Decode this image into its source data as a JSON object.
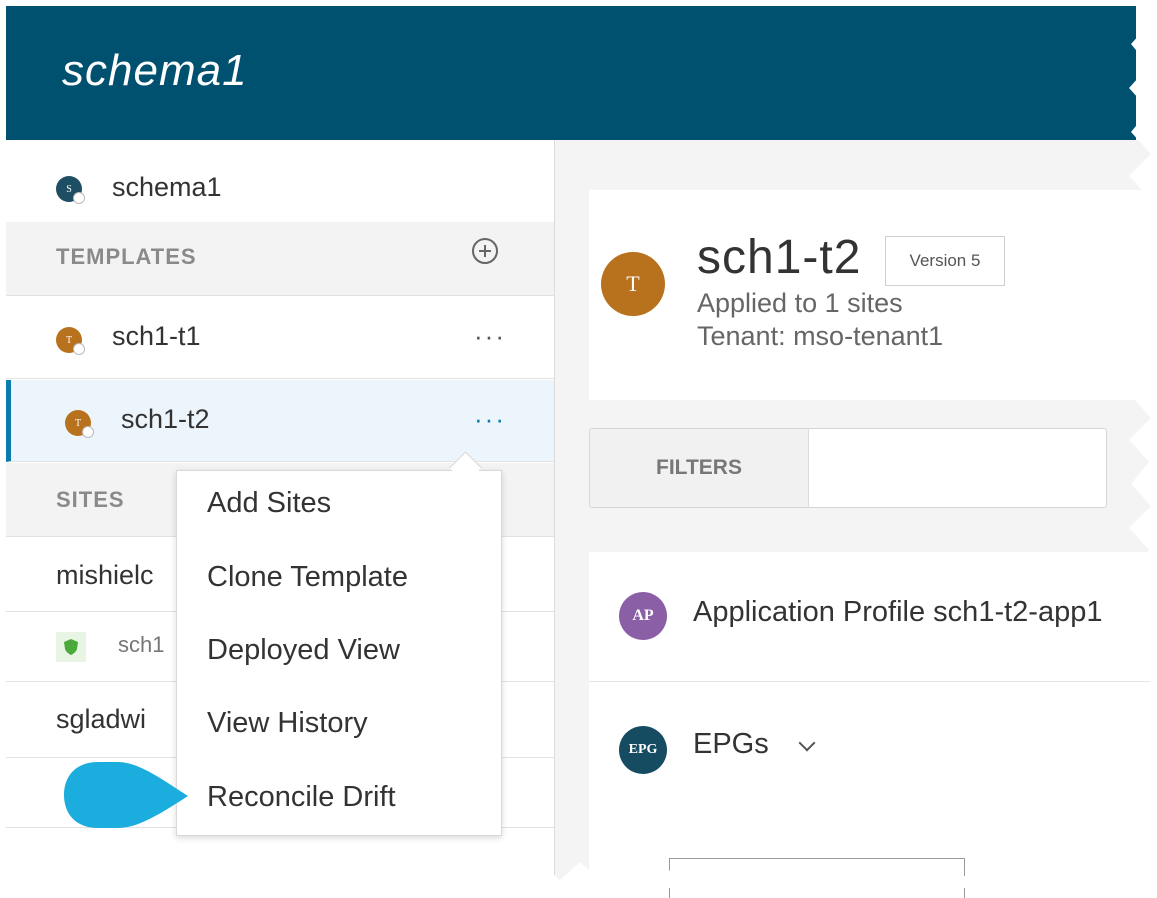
{
  "header": {
    "title": "schema1"
  },
  "sidebar": {
    "schema_name": "schema1",
    "templates_label": "TEMPLATES",
    "templates": [
      {
        "label": "sch1-t1",
        "badge": "T"
      },
      {
        "label": "sch1-t2",
        "badge": "T"
      }
    ],
    "sites_label": "SITES",
    "sites": [
      "mishielc",
      "sch1",
      "sgladwi"
    ]
  },
  "context_menu": {
    "items": [
      "Add Sites",
      "Clone Template",
      "Deployed View",
      "View History",
      "Reconcile Drift"
    ]
  },
  "template": {
    "avatar": "T",
    "name": "sch1-t2",
    "version": "Version 5",
    "applied": "Applied to 1 sites",
    "tenant": "Tenant: mso-tenant1"
  },
  "filters": {
    "label": "FILTERS"
  },
  "objects": {
    "app_profile": {
      "badge": "AP",
      "label": "Application Profile sch1-t2-app1"
    },
    "epgs": {
      "badge": "EPG",
      "label": "EPGs"
    }
  },
  "colors": {
    "header_bg": "#00506f",
    "template_orange": "#b8711c",
    "schema_teal": "#1e4e64",
    "ap_purple": "#8a5fa6",
    "epg_teal": "#154c62",
    "selected_accent": "#0a7bb0",
    "pointer_blue": "#1badde"
  }
}
